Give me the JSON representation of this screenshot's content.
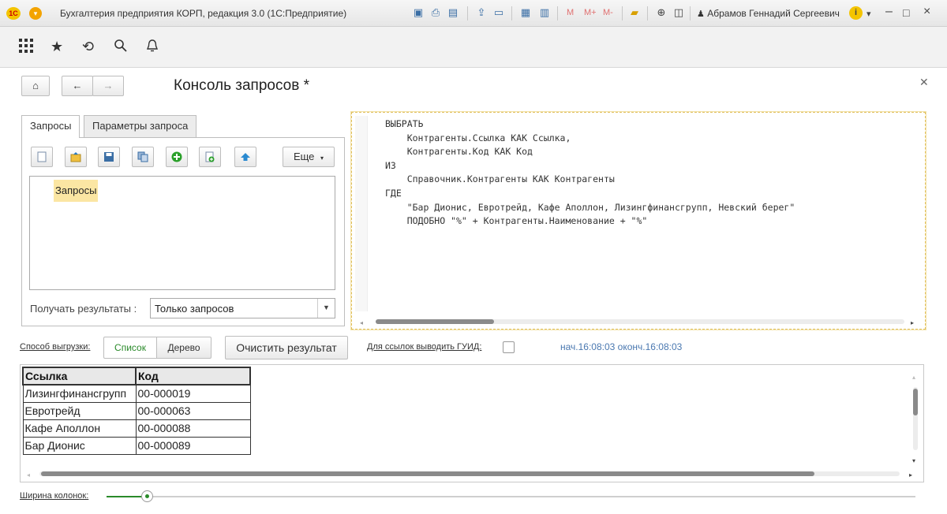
{
  "window": {
    "title": "Бухгалтерия предприятия КОРП, редакция 3.0  (1С:Предприятие)",
    "logo_text": "1С",
    "user": "Абрамов Геннадий Сергеевич",
    "memory_labels": [
      "M",
      "M+",
      "M-"
    ]
  },
  "form": {
    "title": "Консоль запросов *"
  },
  "tabs": [
    {
      "label": "Запросы",
      "active": true
    },
    {
      "label": "Параметры запроса",
      "active": false
    }
  ],
  "toolbar": {
    "more_label": "Еще",
    "icons": [
      "new-document-icon",
      "open-folder-icon",
      "save-icon",
      "copy-icon",
      "add-icon",
      "add-sheet-icon",
      "move-up-icon"
    ]
  },
  "tree": {
    "item": "Запросы"
  },
  "get_results": {
    "label": "Получать результаты :",
    "value": "Только запросов"
  },
  "editor": {
    "lines": [
      "ВЫБРАТЬ",
      "    Контрагенты.Ссылка КАК Ссылка,",
      "    Контрагенты.Код КАК Код",
      "ИЗ",
      "    Справочник.Контрагенты КАК Контрагенты",
      "ГДЕ",
      "    \"Бар Дионис, Евротрейд, Кафе Аполлон, Лизингфинансгрупп, Невский берег\"",
      "    ПОДОБНО \"%\" + Контрагенты.Наименование + \"%\""
    ]
  },
  "actions": {
    "export_label": "Способ выгрузки:",
    "mode_list": "Список",
    "mode_tree": "Дерево",
    "clear_label": "Очистить результат",
    "guid_label": "Для ссылок выводить ГУИД:",
    "guid_checked": false,
    "time_info": "нач.16:08:03  оконч.16:08:03"
  },
  "result": {
    "columns": [
      "Ссылка",
      "Код"
    ],
    "rows": [
      [
        "Лизингфинансгрупп",
        "00-000019"
      ],
      [
        "Евротрейд",
        "00-000063"
      ],
      [
        "Кафе Аполлон",
        "00-000088"
      ],
      [
        "Бар Дионис",
        "00-000089"
      ]
    ]
  },
  "column_width": {
    "label": "Ширина колонок:",
    "value_fraction": 0.05
  },
  "colors": {
    "accent_green": "#2a8a2a",
    "highlight_yellow": "#fbe6a3",
    "link_blue": "#4a78b0"
  }
}
